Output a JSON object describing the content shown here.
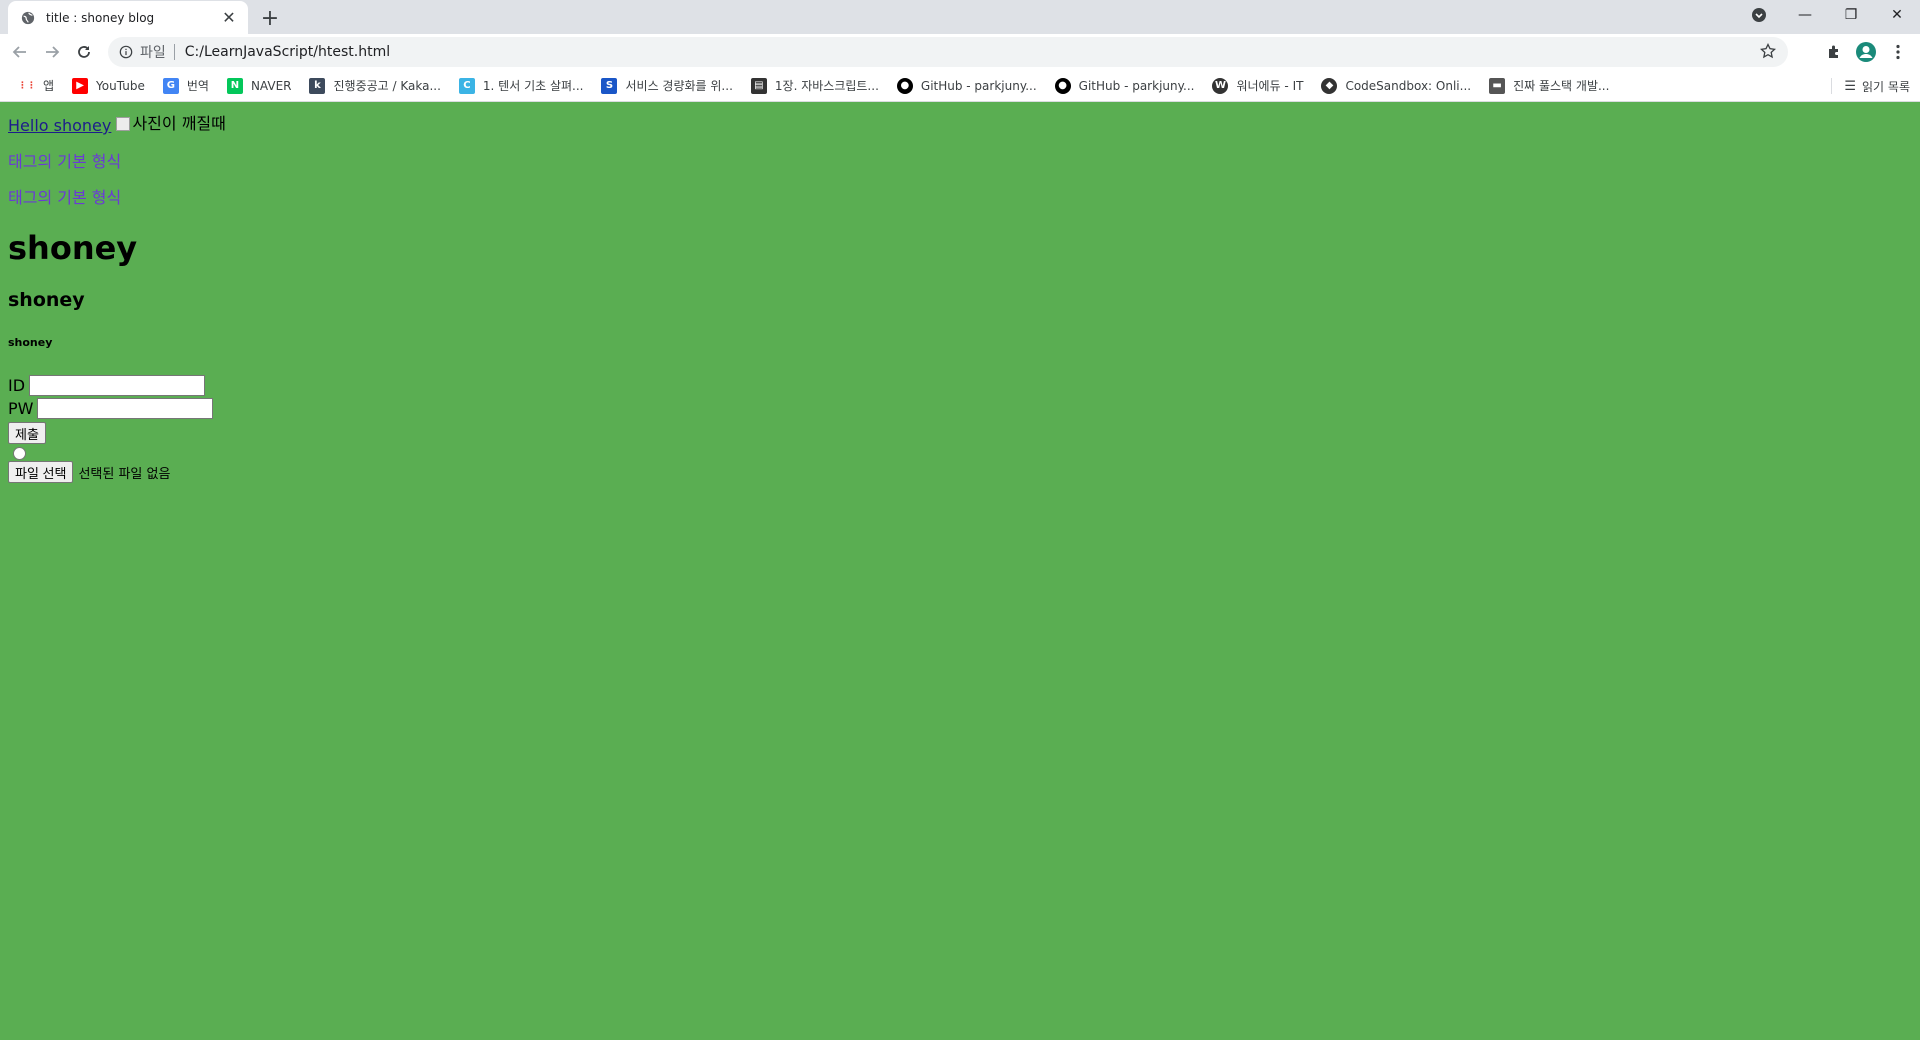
{
  "browser": {
    "tab_title": "title : shoney blog",
    "url_chip": "파일",
    "url": "C:/LearnJavaScript/htest.html"
  },
  "bookmarks": [
    {
      "label": "앱",
      "icon": "apps-grid-icon",
      "color": "#ea4335"
    },
    {
      "label": "YouTube",
      "icon": "youtube-icon",
      "color": "#ff0000"
    },
    {
      "label": "번역",
      "icon": "translate-icon",
      "color": "#4285f4"
    },
    {
      "label": "NAVER",
      "icon": "naver-icon",
      "color": "#03c75a"
    },
    {
      "label": "진행중공고 / Kaka...",
      "icon": "kakao-icon",
      "color": "#3d4a5c"
    },
    {
      "label": "1. 텐서 기초 살펴...",
      "icon": "c-icon",
      "color": "#3bb4e5"
    },
    {
      "label": "서비스 경량화를 위...",
      "icon": "s-icon",
      "color": "#1a56c7"
    },
    {
      "label": "1장. 자바스크립트...",
      "icon": "book-icon",
      "color": "#333333"
    },
    {
      "label": "GitHub - parkjuny...",
      "icon": "github-icon",
      "color": "#000000"
    },
    {
      "label": "GitHub - parkjuny...",
      "icon": "github-icon",
      "color": "#000000"
    },
    {
      "label": "워너에듀 - IT",
      "icon": "wanna-icon",
      "color": "#333333"
    },
    {
      "label": "CodeSandbox: Onli...",
      "icon": "codesandbox-icon",
      "color": "#333333"
    },
    {
      "label": "진짜 풀스택 개발...",
      "icon": "keyboard-icon",
      "color": "#555555"
    }
  ],
  "reading_list": "읽기 목록",
  "page": {
    "link_text": "Hello shoney",
    "img_alt": "사진이 깨질때",
    "para1": "태그의 기본 형식",
    "para2": "태그의 기본 형식",
    "h1": "shoney",
    "h3": "shoney",
    "h6": "shoney",
    "form": {
      "id_label": "ID",
      "pw_label": "PW",
      "submit_label": "제출",
      "file_button": "파일 선택",
      "file_status": "선택된 파일 없음"
    }
  },
  "colors": {
    "page_bg": "#5aae52",
    "para_color": "#6a3ad6"
  }
}
